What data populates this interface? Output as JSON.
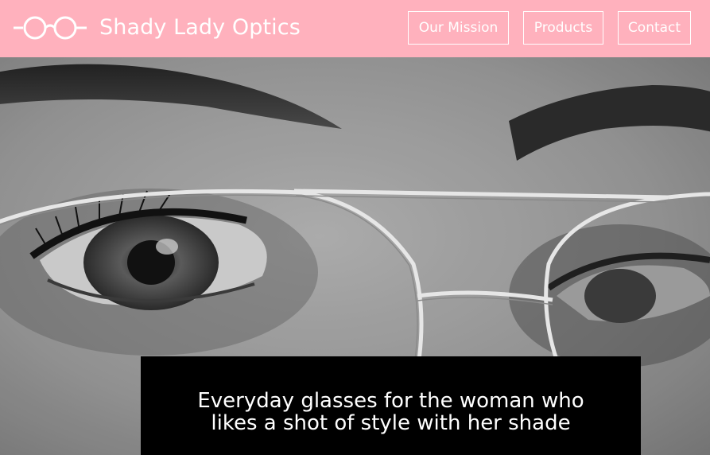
{
  "brand": {
    "name": "Shady Lady Optics",
    "logo_icon": "glasses-icon",
    "color": "#ffb1bd"
  },
  "nav": {
    "items": [
      {
        "label": "Our Mission"
      },
      {
        "label": "Products"
      },
      {
        "label": "Contact"
      }
    ]
  },
  "hero": {
    "image": "close-up-face-with-glasses-photo",
    "tagline_line1": "Everyday glasses for the woman who",
    "tagline_line2": "likes a shot of style with her shade"
  }
}
